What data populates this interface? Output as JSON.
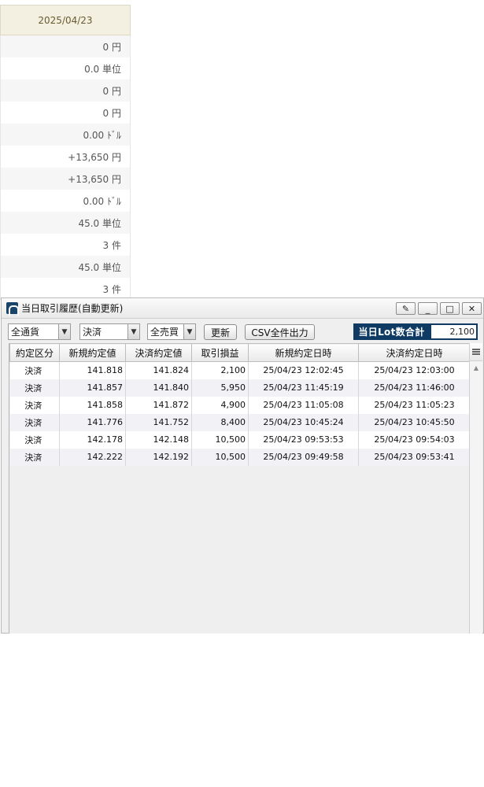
{
  "summary": {
    "date": "2025/04/23",
    "rows": [
      "0 円",
      "0.0 単位",
      "0 円",
      "0 円",
      "0.00 ﾄﾞﾙ",
      "+13,650 円",
      "+13,650 円",
      "0.00 ﾄﾞﾙ",
      "45.0 単位",
      "3 件",
      "45.0 単位",
      "3 件"
    ]
  },
  "window": {
    "title": "当日取引履歴(自動更新)",
    "buttons": {
      "pin": "✎",
      "minimize": "_",
      "maximize": "□",
      "close": "✕"
    }
  },
  "toolbar": {
    "currency_filter": "全通貨",
    "type_filter": "決済",
    "side_filter": "全売買",
    "refresh_label": "更新",
    "csv_label": "CSV全件出力",
    "lot_label": "当日Lot数合計",
    "lot_value": "2,100"
  },
  "table": {
    "headers": [
      "約定区分",
      "新規約定値",
      "決済約定値",
      "取引損益",
      "新規約定日時",
      "決済約定日時"
    ],
    "rows": [
      [
        "決済",
        "141.818",
        "141.824",
        "2,100",
        "25/04/23 12:02:45",
        "25/04/23 12:03:00"
      ],
      [
        "決済",
        "141.857",
        "141.840",
        "5,950",
        "25/04/23 11:45:19",
        "25/04/23 11:46:00"
      ],
      [
        "決済",
        "141.858",
        "141.872",
        "4,900",
        "25/04/23 11:05:08",
        "25/04/23 11:05:23"
      ],
      [
        "決済",
        "141.776",
        "141.752",
        "8,400",
        "25/04/23 10:45:24",
        "25/04/23 10:45:50"
      ],
      [
        "決済",
        "142.178",
        "142.148",
        "10,500",
        "25/04/23 09:53:53",
        "25/04/23 09:54:03"
      ],
      [
        "決済",
        "142.222",
        "142.192",
        "10,500",
        "25/04/23 09:49:58",
        "25/04/23 09:53:41"
      ]
    ]
  }
}
